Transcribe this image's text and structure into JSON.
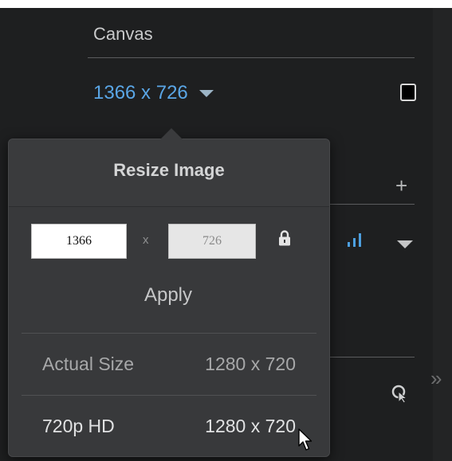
{
  "canvas_panel": {
    "heading": "Canvas",
    "size_value": "1366 x 726",
    "caret_icon": "caret-down-icon",
    "swatch_color": "#000000",
    "add_icon": "plus-icon",
    "add_label": "+",
    "levels_icon": "signal-bars-icon",
    "menu_icon": "caret-down-icon",
    "target_icon": "target-pointer-icon",
    "expand_icon": "double-chevron-right-icon",
    "expand_label": "»"
  },
  "resize_popover": {
    "title": "Resize Image",
    "width_value": "1366",
    "times_label": "x",
    "height_value": "726",
    "lock_icon": "lock-icon",
    "apply_label": "Apply",
    "presets": [
      {
        "name": "Actual Size",
        "dims": "1280 x 720"
      },
      {
        "name": "720p HD",
        "dims": "1280 x 720"
      }
    ]
  },
  "colors": {
    "accent": "#5aa6e6",
    "panel_bg": "#1e1f20",
    "popover_bg": "#38393b"
  }
}
